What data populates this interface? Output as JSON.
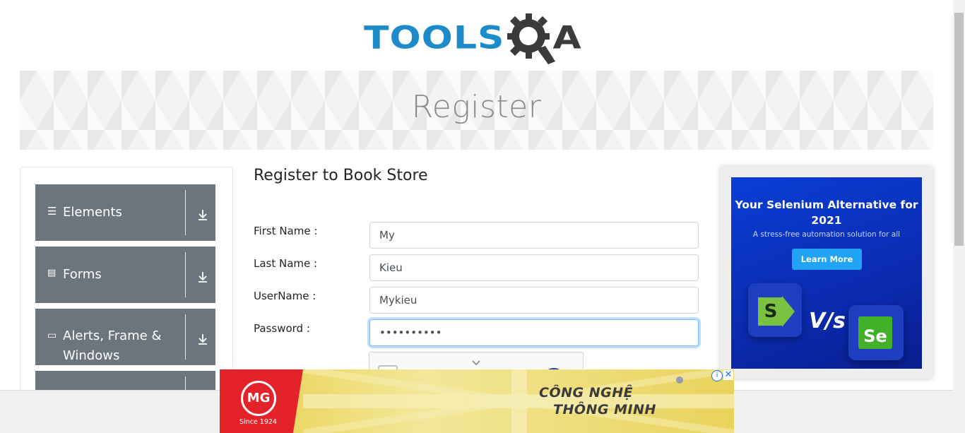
{
  "logo": {
    "tools": "TOOLS",
    "a": "A"
  },
  "banner": {
    "title": "Register"
  },
  "sidebar": {
    "groups": [
      {
        "label": "Elements",
        "icon": "hamburger-icon"
      },
      {
        "label": "Forms",
        "icon": "document-icon"
      },
      {
        "label": "Alerts, Frame & Windows",
        "icon": "window-icon"
      },
      {
        "label": "",
        "icon": ""
      }
    ]
  },
  "form": {
    "title": "Register to Book Store",
    "fields": [
      {
        "label": "First Name :",
        "value": "My"
      },
      {
        "label": "Last Name :",
        "value": "Kieu"
      },
      {
        "label": "UserName :",
        "value": "Mykieu"
      },
      {
        "label": "Password :",
        "value": "••••••••••"
      }
    ]
  },
  "right_ad": {
    "title": "Your Selenium Alternative for 2021",
    "subtitle": "A stress-free automation solution for all",
    "button": "Learn More",
    "vs": "V/s",
    "left_logo": "S",
    "right_logo": "Se"
  },
  "bottom_ad": {
    "brand": "MG",
    "since": "Since 1924",
    "line1": "CÔNG NGHỆ",
    "line2": "THÔNG MINH",
    "colors": {
      "red": "#e42229",
      "yellow": "#e9d35a"
    }
  },
  "colors": {
    "accent_blue": "#1d8bc9",
    "sidebar_gray": "#6c757d"
  }
}
